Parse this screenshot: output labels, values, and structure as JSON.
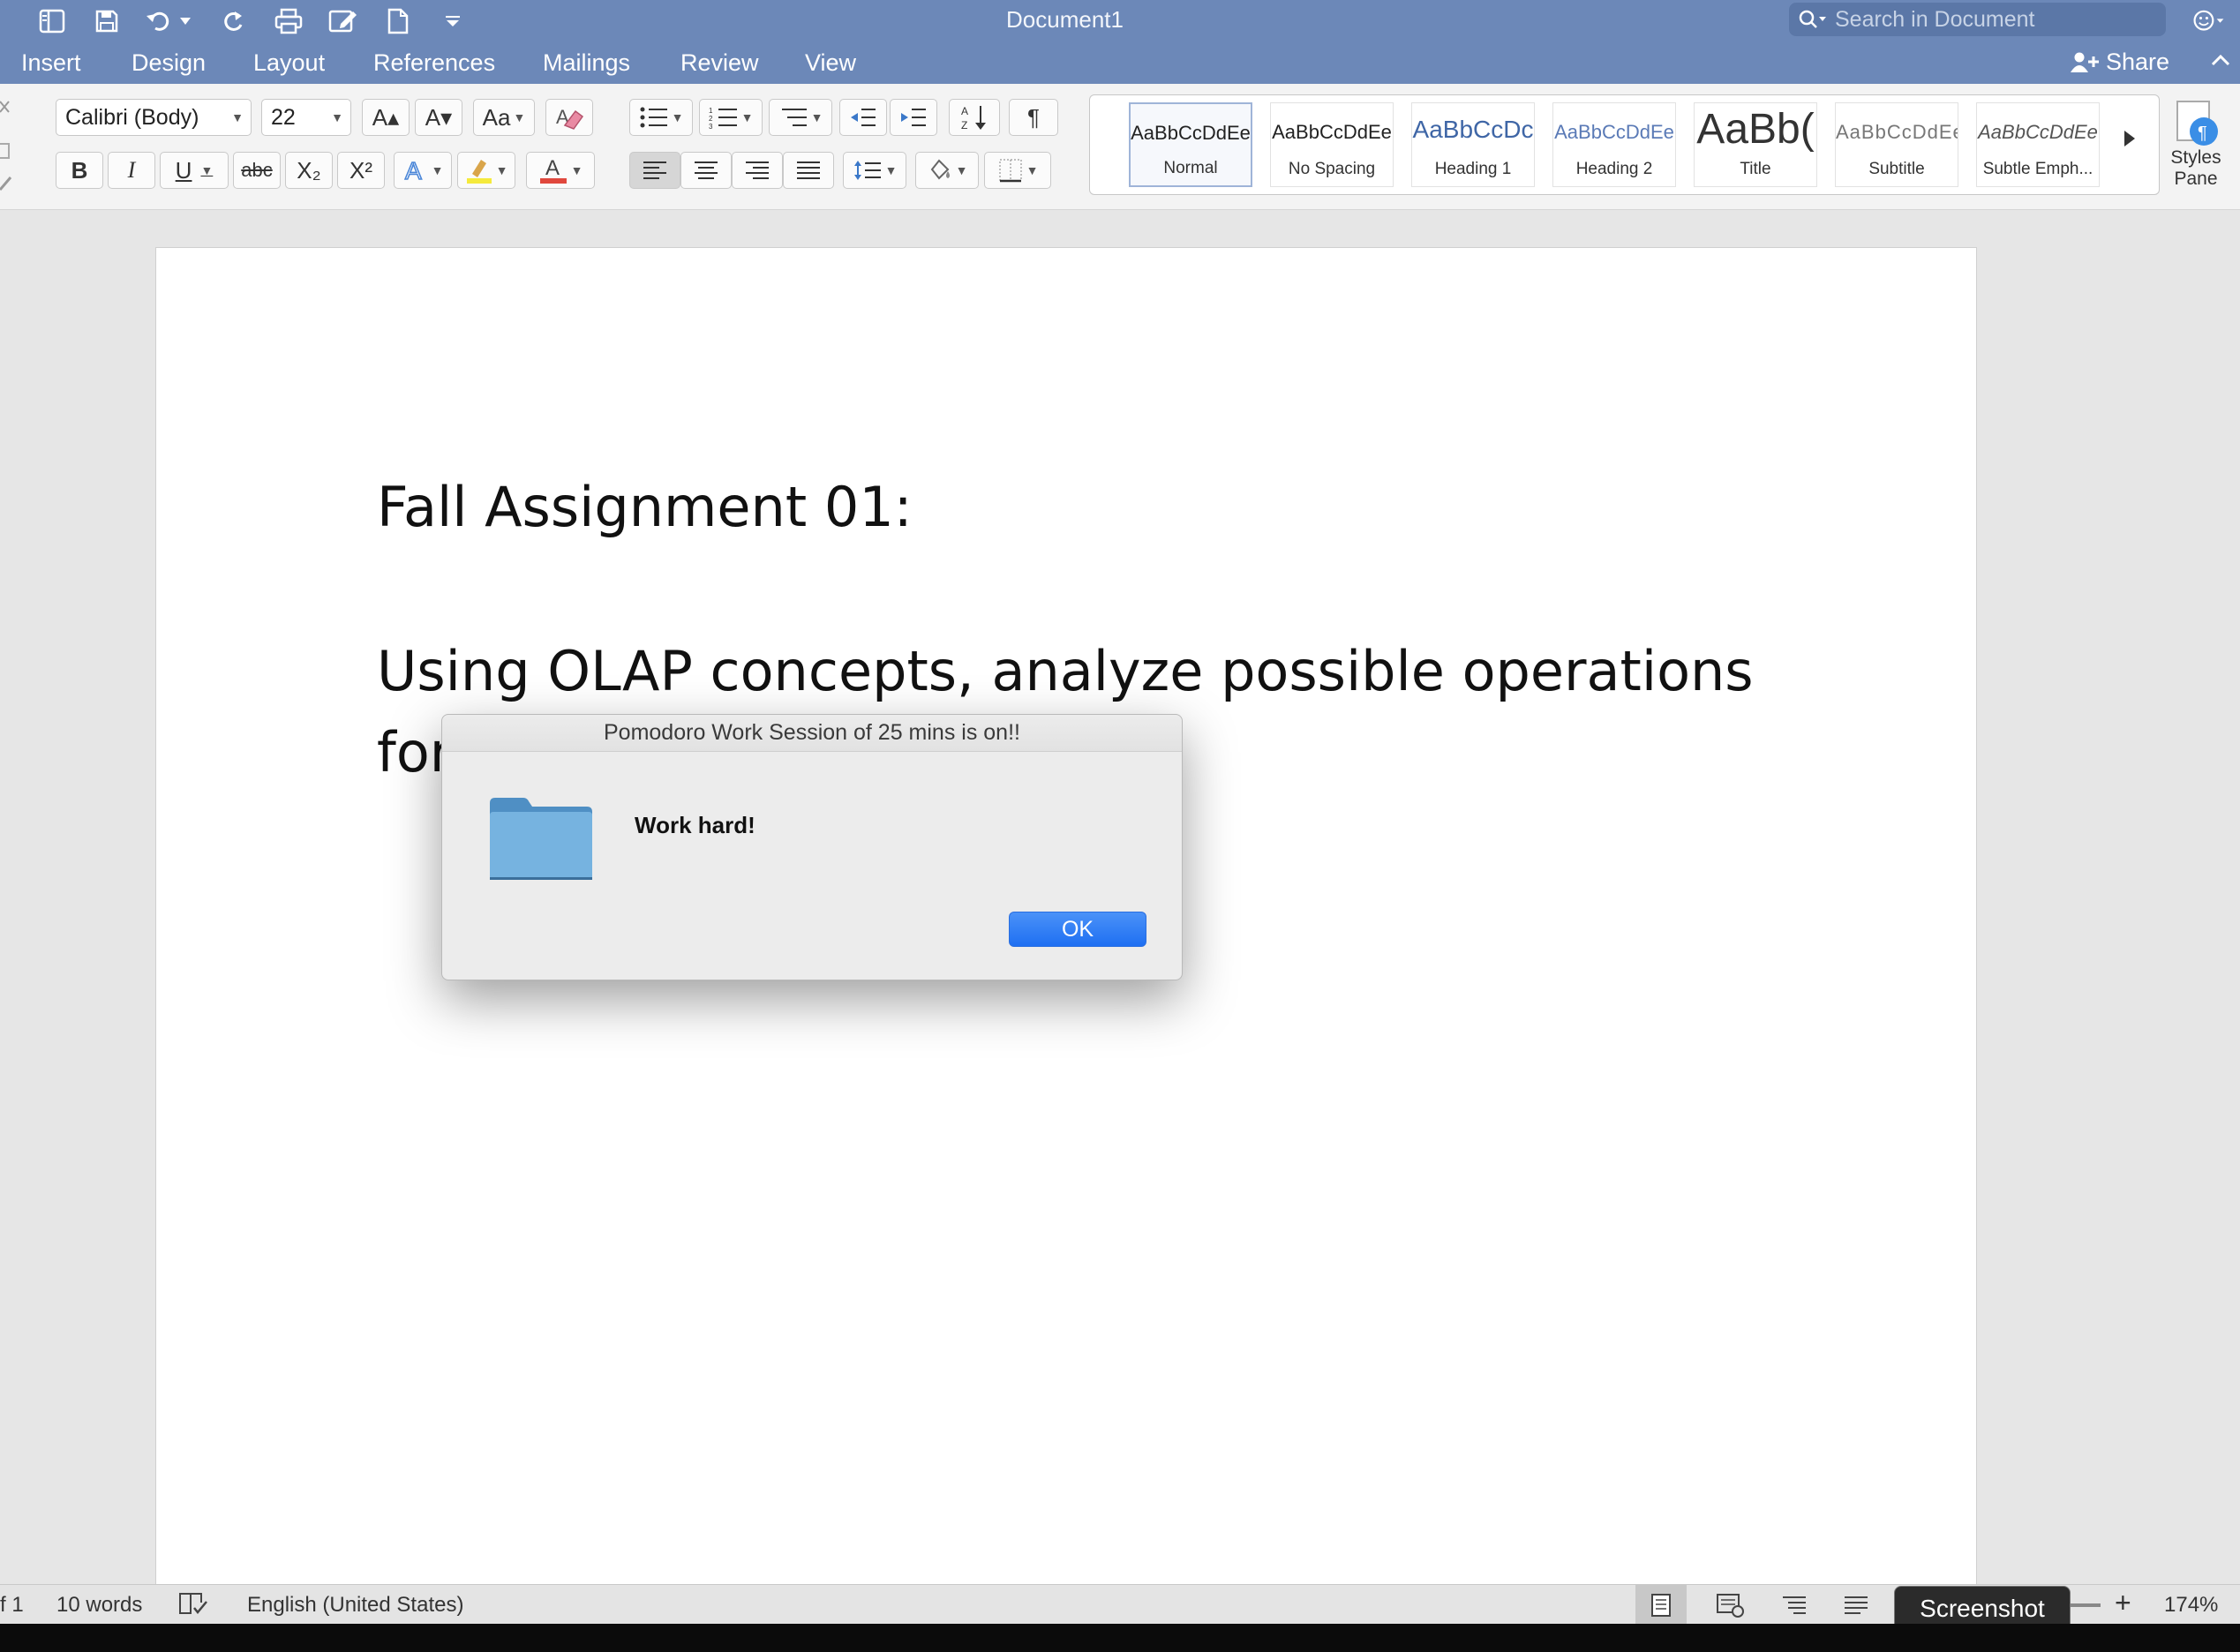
{
  "window": {
    "title": "Document1",
    "search_placeholder": "Search in Document"
  },
  "menu": {
    "items": [
      "Insert",
      "Design",
      "Layout",
      "References",
      "Mailings",
      "Review",
      "View"
    ],
    "share_label": "Share"
  },
  "ribbon": {
    "font_name": "Calibri (Body)",
    "font_size": "22",
    "bold": "B",
    "italic": "I",
    "underline": "U",
    "strikethrough": "abc",
    "subscript": "X₂",
    "superscript": "X²",
    "grow_font": "A▴",
    "shrink_font": "A▾",
    "change_case": "Aa",
    "pilcrow": "¶",
    "styles": [
      {
        "sample": "AaBbCcDdEe",
        "name": "Normal"
      },
      {
        "sample": "AaBbCcDdEe",
        "name": "No Spacing"
      },
      {
        "sample": "AaBbCcDc",
        "name": "Heading 1"
      },
      {
        "sample": "AaBbCcDdEe",
        "name": "Heading 2"
      },
      {
        "sample": "AaBb(",
        "name": "Title"
      },
      {
        "sample": "AaBbCcDdEe",
        "name": "Subtitle"
      },
      {
        "sample": "AaBbCcDdEe",
        "name": "Subtle Emph..."
      }
    ],
    "styles_pane_label_1": "Styles",
    "styles_pane_label_2": "Pane"
  },
  "document": {
    "line1": "Fall Assignment 01:",
    "line2": "Using OLAP concepts, analyze possible operations",
    "line3": "for"
  },
  "dialog": {
    "title": "Pomodoro Work Session of 25 mins is on!!",
    "message": "Work hard!",
    "ok_label": "OK"
  },
  "status": {
    "page_fragment": "f 1",
    "word_count": "10 words",
    "language": "English (United States)",
    "zoom": "174%",
    "tooltip": "Screenshot"
  },
  "colors": {
    "titlebar": "#6c88b8",
    "ok_button": "#1e6ff2",
    "folder": "#6fa8d6"
  }
}
